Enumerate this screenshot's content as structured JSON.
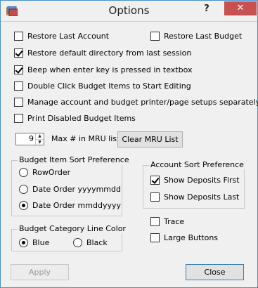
{
  "window": {
    "title": "Options",
    "help_glyph": "?",
    "close_glyph": "✕"
  },
  "options": {
    "restore_last_account": {
      "label": "Restore Last Account",
      "checked": false
    },
    "restore_last_budget": {
      "label": "Restore Last Budget",
      "checked": false
    },
    "restore_default_directory": {
      "label": "Restore default directory from last session",
      "checked": true
    },
    "beep_enter_key": {
      "label": "Beep when enter key is pressed in textbox",
      "checked": true
    },
    "double_click_budget": {
      "label": "Double Click Budget Items to Start Editing",
      "checked": false
    },
    "manage_printer_setups": {
      "label": "Manage account and budget printer/page setups separately",
      "checked": false
    },
    "print_disabled_budget": {
      "label": "Print Disabled Budget Items",
      "checked": false
    }
  },
  "mru": {
    "value": "9",
    "label": "Max # in MRU list",
    "clear_button": "Clear MRU List"
  },
  "budget_sort": {
    "title": "Budget Item Sort Preference",
    "options": [
      {
        "label": "RowOrder",
        "checked": false
      },
      {
        "label": "Date Order yyyymmdd",
        "checked": false
      },
      {
        "label": "Date Order mmddyyyy",
        "checked": true
      }
    ]
  },
  "account_sort": {
    "title": "Account Sort Preference",
    "show_deposits_first": {
      "label": "Show Deposits First",
      "checked": true
    },
    "show_deposits_last": {
      "label": "Show Deposits Last",
      "checked": false
    }
  },
  "line_color": {
    "title": "Budget Category Line Color",
    "options": [
      {
        "label": "Blue",
        "checked": true
      },
      {
        "label": "Black",
        "checked": false
      }
    ]
  },
  "misc": {
    "trace": {
      "label": "Trace",
      "checked": false
    },
    "large_buttons": {
      "label": "Large Buttons",
      "checked": false
    }
  },
  "buttons": {
    "apply": "Apply",
    "close": "Close"
  }
}
